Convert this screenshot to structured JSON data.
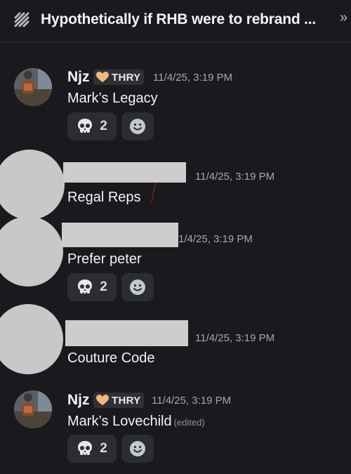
{
  "header": {
    "title": "Hypothetically if RHB were to rebrand ...",
    "thread_icon": "thread-icon",
    "overflow_glyph": "»"
  },
  "messages": [
    {
      "author": "Njz",
      "tag": "THRY",
      "time": "11/4/25, 3:19 PM",
      "text": "Mark’s Legacy",
      "edited": "",
      "reaction": {
        "emoji": "skull-icon",
        "count": "2"
      }
    },
    {
      "author": "",
      "tag": "",
      "time": "11/4/25, 3:19 PM",
      "text": "Regal Reps",
      "edited": "",
      "reaction": null
    },
    {
      "author": "",
      "tag": "",
      "time": "1/4/25, 3:19 PM",
      "text": "Prefer peter",
      "edited": "",
      "reaction": {
        "emoji": "skull-icon",
        "count": "2"
      }
    },
    {
      "author": "",
      "tag": "",
      "time": "11/4/25, 3:19 PM",
      "text": "Couture Code",
      "edited": "",
      "reaction": null
    },
    {
      "author": "Njz",
      "tag": "THRY",
      "time": "11/4/25, 3:19 PM",
      "text": "Mark’s Lovechild",
      "edited": "(edited)",
      "reaction": {
        "emoji": "skull-icon",
        "count": "2"
      }
    }
  ],
  "colors": {
    "background": "#1a1a1e",
    "tag_heart": "#f2b879",
    "redaction": "#c8c8c8",
    "reaction_bg": "#2b2d31"
  }
}
